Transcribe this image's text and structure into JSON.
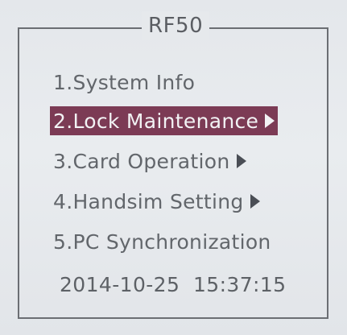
{
  "device": {
    "title": "RF50"
  },
  "menu": {
    "items": [
      {
        "label": "1.System Info",
        "has_submenu": false,
        "selected": false
      },
      {
        "label": "2.Lock Maintenance",
        "has_submenu": true,
        "selected": true
      },
      {
        "label": "3.Card Operation",
        "has_submenu": true,
        "selected": false
      },
      {
        "label": "4.Handsim Setting",
        "has_submenu": true,
        "selected": false
      },
      {
        "label": "5.PC Synchronization",
        "has_submenu": false,
        "selected": false
      }
    ],
    "arrow_icon": "triangle-right-icon",
    "highlight_color": "#7c3b55"
  },
  "status": {
    "datetime": "2014-10-25  15:37:15"
  }
}
